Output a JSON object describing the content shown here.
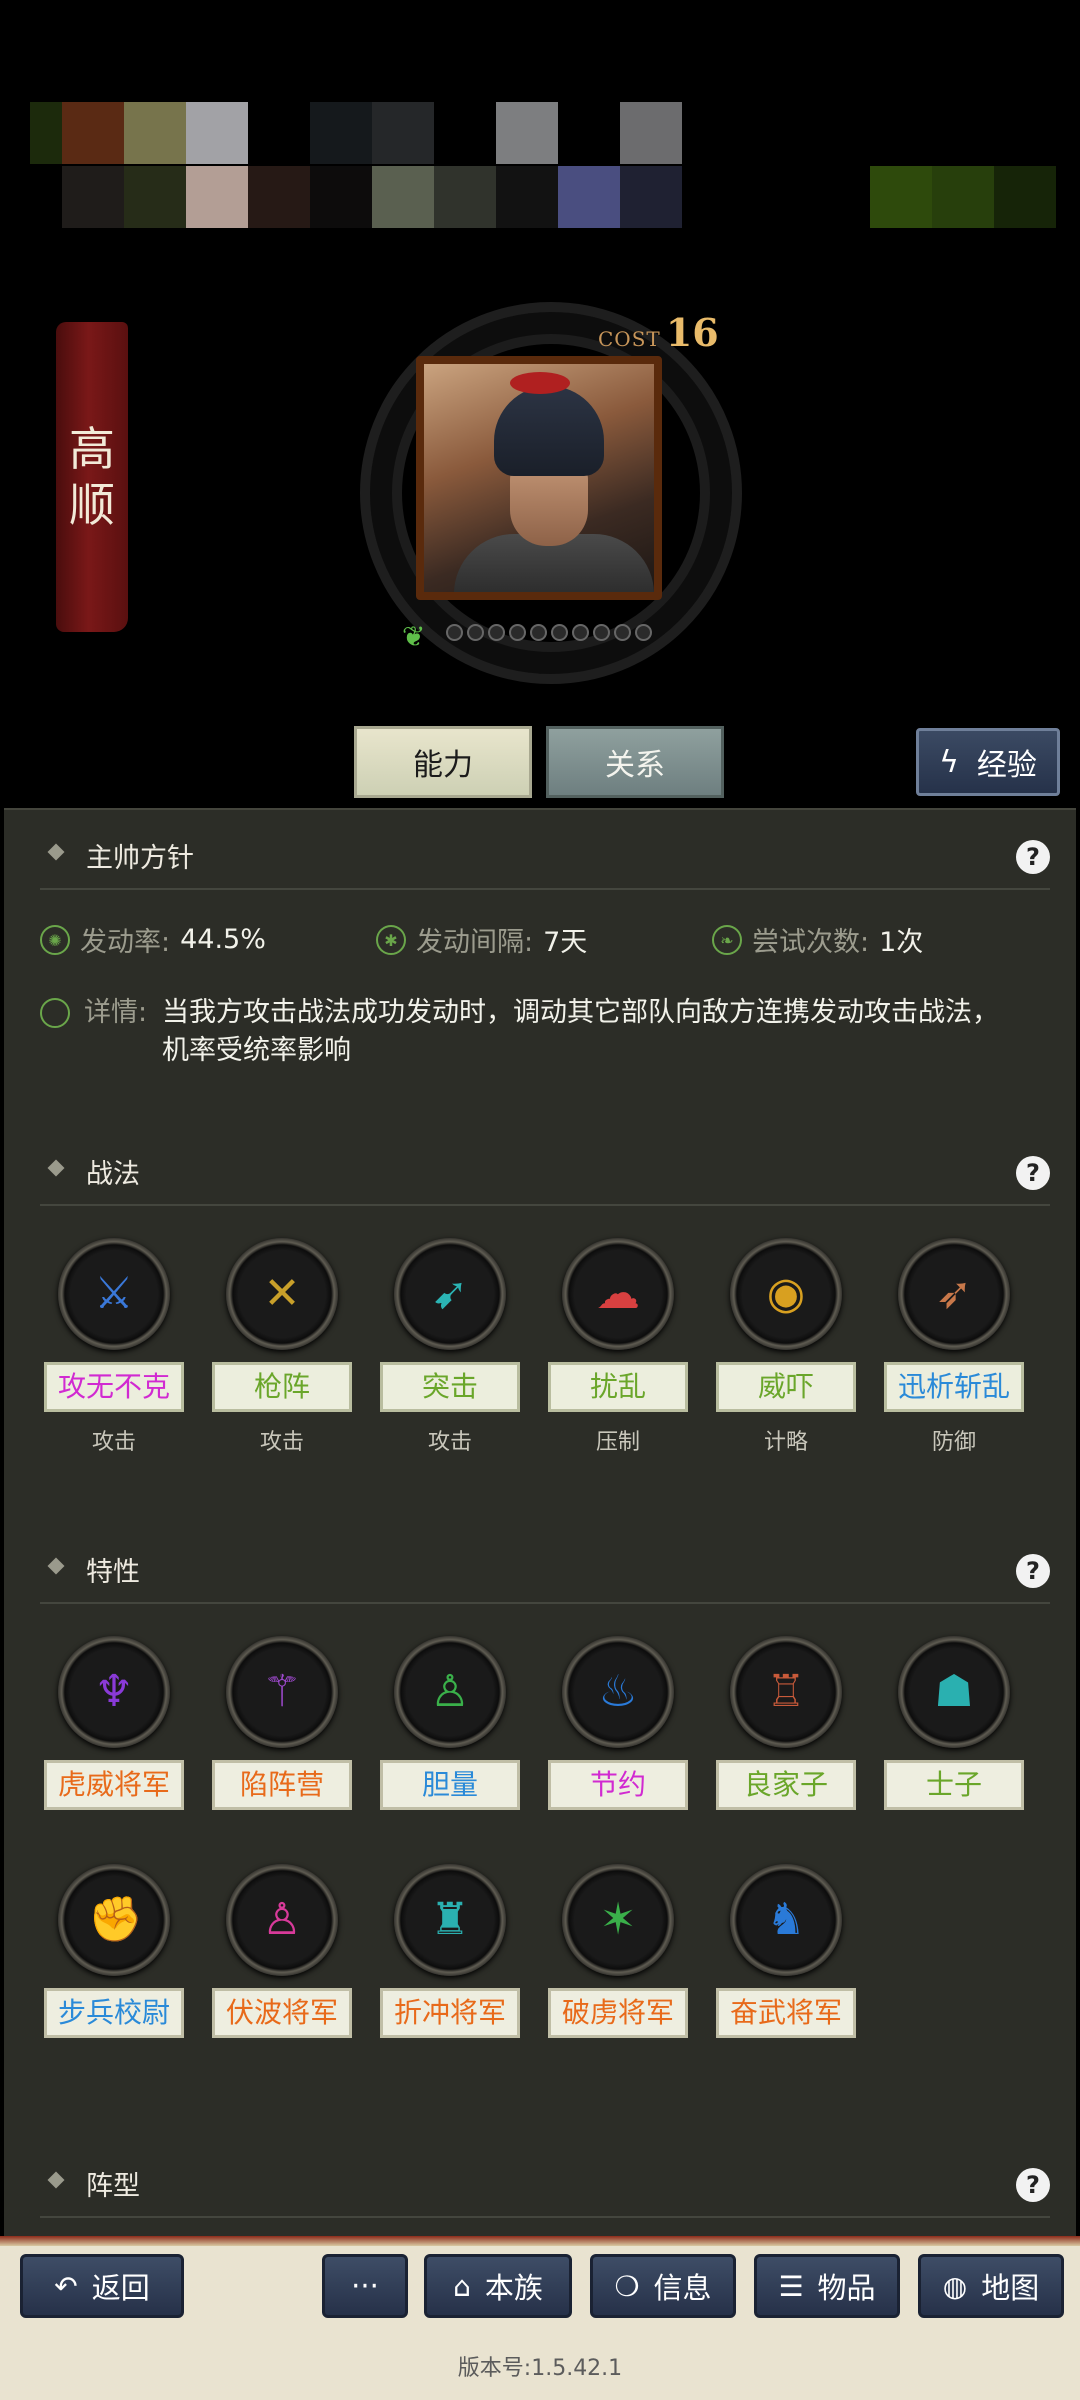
{
  "hero": {
    "name_chars": [
      "高",
      "顺"
    ],
    "cost_label": "COST",
    "cost_value": "16",
    "heart_icon": "heart-icon",
    "star_count": 10
  },
  "tabs": {
    "ability": "能力",
    "relation": "关系"
  },
  "experience_button": "经验",
  "sections": {
    "commander": {
      "title": "主帅方针",
      "help": "?",
      "stats": [
        {
          "label": "发动率:",
          "value": "44.5%"
        },
        {
          "label": "发动间隔:",
          "value": "7天"
        },
        {
          "label": "尝试次数:",
          "value": "1次"
        }
      ],
      "detail_label": "详情:",
      "detail_text": "当我方攻击战法成功发动时，调动其它部队向敌方连携发动攻击战法，机率受统率影响"
    },
    "tactics": {
      "title": "战法",
      "help": "?",
      "items": [
        {
          "name": "攻无不克",
          "category": "攻击",
          "color": "#d12ad1",
          "icon": "knight-shield-icon",
          "glyph": "⚔",
          "glyph_color": "#3a78d8"
        },
        {
          "name": "枪阵",
          "category": "攻击",
          "color": "#6aa62a",
          "icon": "crossed-spears-shield-icon",
          "glyph": "✕",
          "glyph_color": "#c9a02a"
        },
        {
          "name": "突击",
          "category": "攻击",
          "color": "#6aa62a",
          "icon": "charging-soldier-icon",
          "glyph": "➹",
          "glyph_color": "#2bb4b4"
        },
        {
          "name": "扰乱",
          "category": "压制",
          "color": "#6aa62a",
          "icon": "cloud-icon",
          "glyph": "☁",
          "glyph_color": "#d84040"
        },
        {
          "name": "威吓",
          "category": "计略",
          "color": "#6aa62a",
          "icon": "mask-icon",
          "glyph": "◉",
          "glyph_color": "#d8a020"
        },
        {
          "name": "迅析斩乱",
          "category": "防御",
          "color": "#2a8ad8",
          "icon": "archer-icon",
          "glyph": "➶",
          "glyph_color": "#c8784a"
        }
      ]
    },
    "traits": {
      "title": "特性",
      "help": "?",
      "items": [
        {
          "name": "虎威将军",
          "color": "#e86a1a",
          "icon": "winged-warrior-icon",
          "glyph": "♆",
          "glyph_color": "#8a3ad8"
        },
        {
          "name": "陷阵营",
          "color": "#e86a1a",
          "icon": "sword-in-stone-icon",
          "glyph": "⚚",
          "glyph_color": "#a04ad0"
        },
        {
          "name": "胆量",
          "color": "#2a8ad8",
          "icon": "person-icon",
          "glyph": "♙",
          "glyph_color": "#3ab04a"
        },
        {
          "name": "节约",
          "color": "#d12ad1",
          "icon": "piggy-bank-icon",
          "glyph": "♨",
          "glyph_color": "#2a7ad8"
        },
        {
          "name": "良家子",
          "color": "#6aa62a",
          "icon": "strongman-icon",
          "glyph": "♖",
          "glyph_color": "#c85a3a"
        },
        {
          "name": "士子",
          "color": "#6aa62a",
          "icon": "scholar-icon",
          "glyph": "☗",
          "glyph_color": "#2ab0b0"
        },
        {
          "name": "步兵校尉",
          "color": "#2a8ad8",
          "icon": "fist-icon",
          "glyph": "✊",
          "glyph_color": "#7a3ac8"
        },
        {
          "name": "伏波将军",
          "color": "#e86a1a",
          "icon": "person-icon",
          "glyph": "♙",
          "glyph_color": "#d83a9a"
        },
        {
          "name": "折冲将军",
          "color": "#e86a1a",
          "icon": "armored-warrior-icon",
          "glyph": "♜",
          "glyph_color": "#2ab0b0"
        },
        {
          "name": "破虏将军",
          "color": "#e86a1a",
          "icon": "spiky-warrior-icon",
          "glyph": "✶",
          "glyph_color": "#3ab04a"
        },
        {
          "name": "奋武将军",
          "color": "#e86a1a",
          "icon": "aura-warrior-icon",
          "glyph": "♞",
          "glyph_color": "#2a7ad8"
        }
      ]
    },
    "formation": {
      "title": "阵型",
      "help": "?"
    }
  },
  "bottom_nav": {
    "back": "返回",
    "more": "···",
    "clan": "本族",
    "info": "信息",
    "items": "物品",
    "map": "地图"
  },
  "version": "版本号:1.5.42.1",
  "colors": {
    "panel_bg": "#2c2d27",
    "accent_green": "#6aa64a",
    "nav_button": "#2f3b55",
    "banner_red": "#7a1818"
  }
}
